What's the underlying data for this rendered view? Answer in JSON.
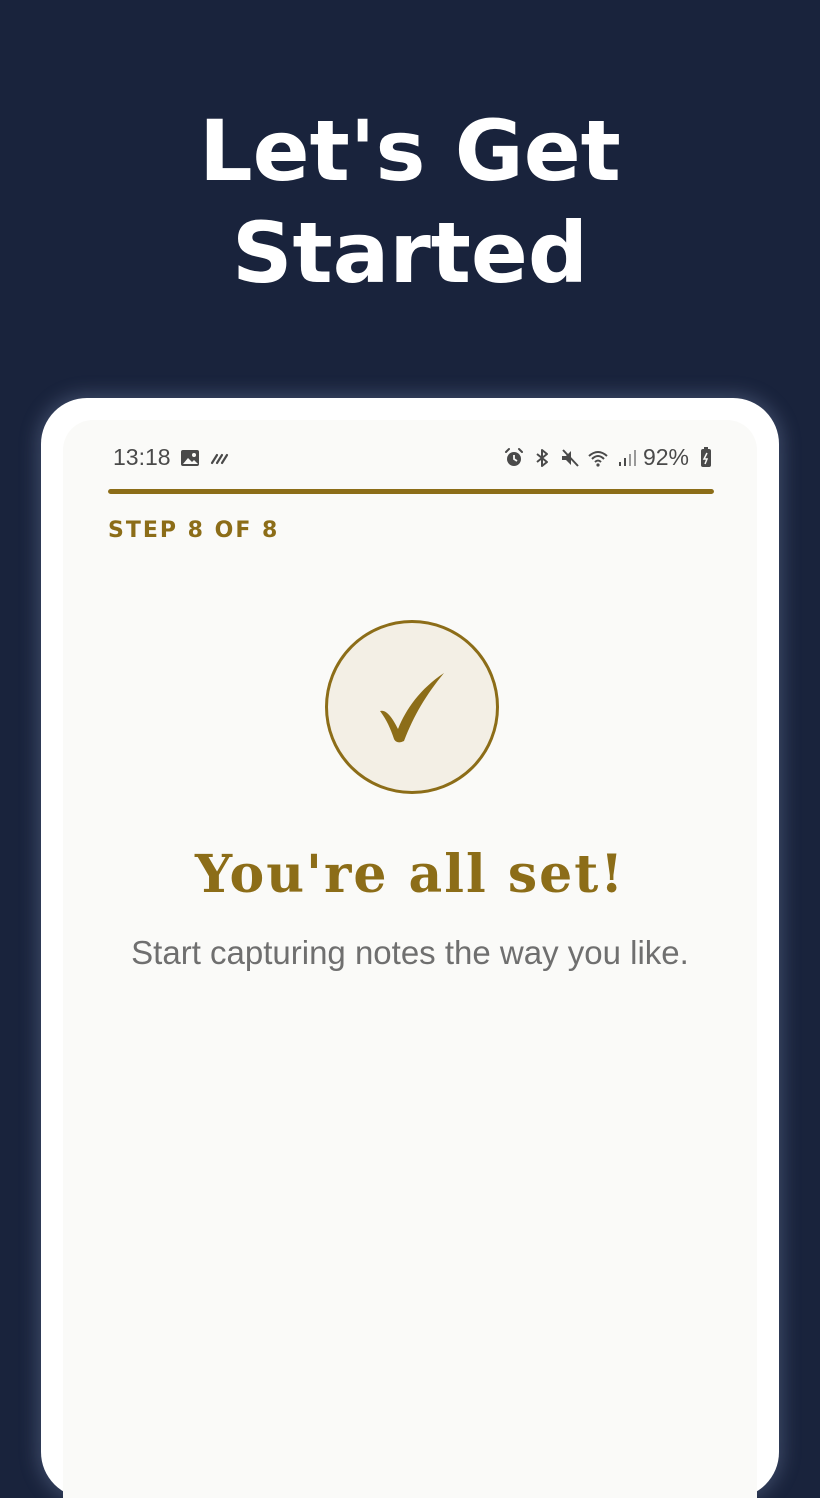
{
  "promo": {
    "headline_line1": "Let's Get",
    "headline_line2": "Started"
  },
  "status_bar": {
    "time": "13:18",
    "battery": "92%",
    "left_icons": [
      "image-notification-icon",
      "fitness-notification-icon"
    ],
    "right_icons": [
      "alarm-icon",
      "bluetooth-icon",
      "mute-icon",
      "wifi-icon",
      "signal-icon",
      "battery-icon"
    ]
  },
  "onboarding": {
    "progress": 1.0,
    "step_label": "STEP 8 OF 8",
    "icon": "checkmark-icon",
    "title": "You're all set!",
    "subtitle": "Start capturing notes the way you like."
  },
  "colors": {
    "background": "#19233c",
    "accent": "#8c6d18",
    "screen": "#fafaf8",
    "subtitle": "#6f6f6f"
  }
}
